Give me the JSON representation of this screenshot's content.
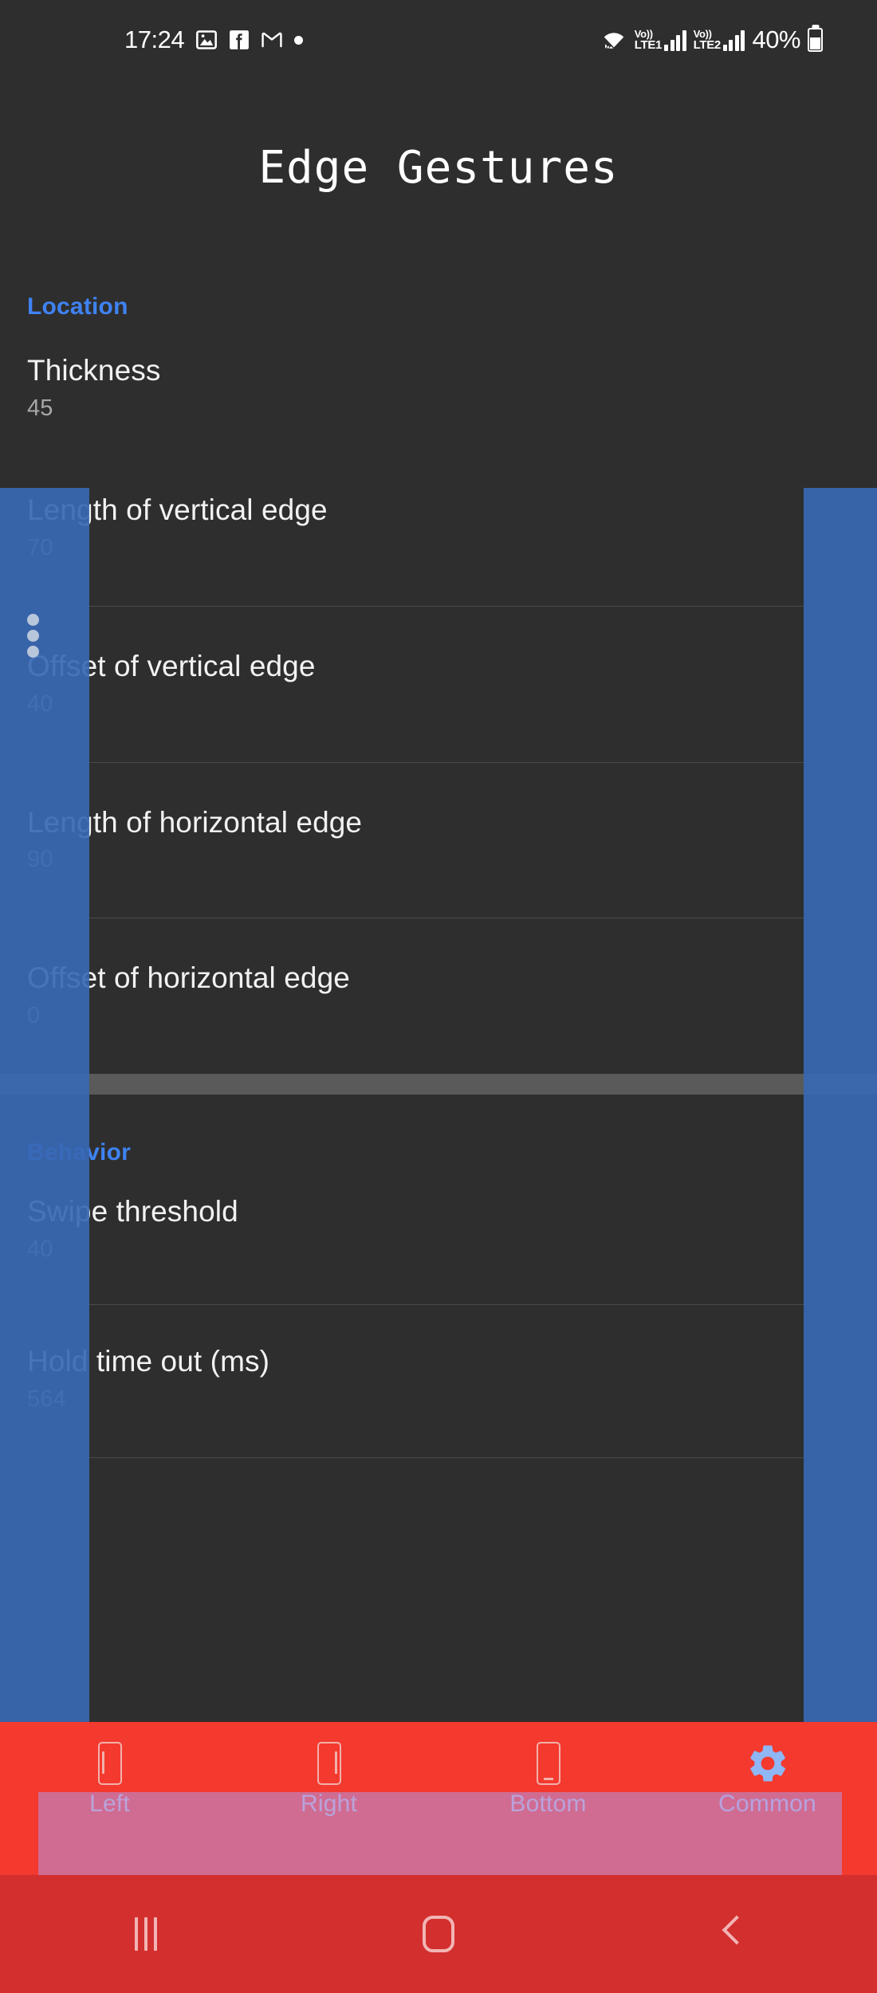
{
  "status_bar": {
    "time": "17:24",
    "left_icons": [
      "gallery-icon",
      "facebook-icon",
      "gmail-icon",
      "dot-icon"
    ],
    "wifi_icon": "wifi-icon",
    "sim1": {
      "volte_top": "Vo))",
      "volte_label": "LTE1"
    },
    "sim2": {
      "volte_top": "Vo))",
      "volte_label": "LTE2"
    },
    "battery_percent": "40%"
  },
  "app": {
    "title": "Edge Gestures"
  },
  "sections": [
    {
      "header": "Location",
      "items": [
        {
          "title": "Thickness",
          "value": "45"
        },
        {
          "title": "Length of vertical edge",
          "value": "70"
        },
        {
          "title": "Offset of vertical edge",
          "value": "40"
        },
        {
          "title": "Length of horizontal edge",
          "value": "90"
        },
        {
          "title": "Offset of horizontal edge",
          "value": "0"
        }
      ]
    },
    {
      "header": "Behavior",
      "items": [
        {
          "title": "Swipe threshold",
          "value": "40"
        },
        {
          "title": "Hold time out (ms)",
          "value": "564"
        }
      ]
    }
  ],
  "tabs": [
    {
      "label": "Left",
      "icon": "phone-left-edge-icon",
      "active": false
    },
    {
      "label": "Right",
      "icon": "phone-right-edge-icon",
      "active": false
    },
    {
      "label": "Bottom",
      "icon": "phone-bottom-edge-icon",
      "active": false
    },
    {
      "label": "Common",
      "icon": "gear-icon",
      "active": true
    }
  ],
  "nav_bar": {
    "recents": "recents-icon",
    "home": "home-icon",
    "back": "back-icon"
  },
  "colors": {
    "accent_blue": "#3f82f2",
    "edge_overlay_blue": "#3868b4",
    "tabbar_red": "#f4392f",
    "navbar_red": "#d32f2f",
    "overlay_purple": "#ba8cd0",
    "background": "#2e2e2e",
    "tab_label": "#b9c8ea",
    "active_tab_label": "#aec6f7"
  }
}
